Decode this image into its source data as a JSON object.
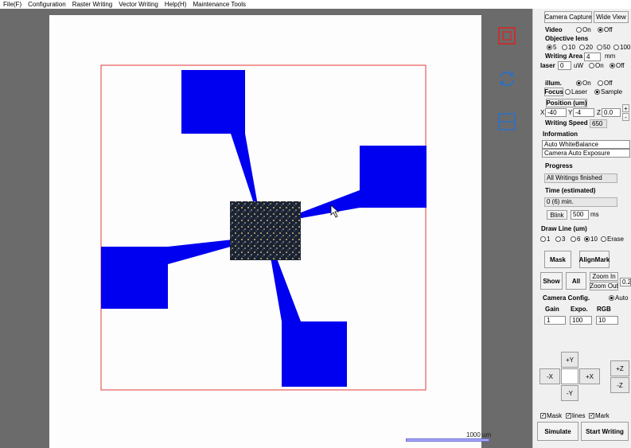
{
  "menu": [
    "File(F)",
    "Configuration",
    "Raster Writing",
    "Vector Writing",
    "Help(H)",
    "Maintenance Tools"
  ],
  "scale_label": "1000 um",
  "tool_icons": [
    "selection-rect-icon",
    "rotate-icon",
    "split-view-icon"
  ],
  "panel": {
    "camera_capture": "Camera Capture",
    "wide_view": "Wide View",
    "video_label": "Video",
    "video_on": "On",
    "video_off": "Off",
    "objective_label": "Objective lens",
    "objective_options": [
      "5",
      "10",
      "20",
      "50",
      "100"
    ],
    "objective_selected": "5",
    "writing_area_label": "Writing Area",
    "writing_area_value": "4",
    "writing_area_unit": "mm",
    "laser_label": "laser",
    "laser_value": "0",
    "laser_unit": "uW",
    "laser_on": "On",
    "laser_off": "Off",
    "illum_label": "illum.",
    "illum_on": "On",
    "illum_off": "Off",
    "focus_label": "Focus",
    "focus_laser": "Laser",
    "focus_sample": "Sample",
    "position_label": "Position (um)",
    "pos_x_label": "X",
    "pos_x": "-40",
    "pos_y_label": "Y",
    "pos_y": "-4",
    "pos_z_label": "Z",
    "pos_z": "0.0",
    "plus": "+",
    "minus": "-",
    "writing_speed_label": "Writing Speed",
    "writing_speed": "650",
    "information_label": "Information",
    "info_lines": [
      "Auto WhiteBalance",
      "Camera Auto Exposure"
    ],
    "progress_label": "Progress",
    "progress_value": "All Writings finished",
    "time_label": "Time (estimated)",
    "time_value": "0 (6) min.",
    "blink_label": "Blink",
    "blink_value": "500",
    "blink_unit": "ms",
    "draw_line_label": "Draw Line (um)",
    "draw_options": [
      "1",
      "3",
      "6",
      "10",
      "Erase"
    ],
    "draw_selected": "10",
    "mask_btn": "Mask",
    "alignmark_btn": "AlignMark",
    "show_btn": "Show",
    "all_btn": "All",
    "zoom_in": "Zoom In",
    "zoom_out": "Zoom Out",
    "zoom_value": "0.2",
    "camera_config_label": "Camera Config.",
    "auto_label": "Auto",
    "gain_label": "Gain",
    "expo_label": "Expo.",
    "rgb_label": "RGB",
    "gain_value": "1",
    "expo_value": "100",
    "rgb_value": "10",
    "jog_plus_y": "+Y",
    "jog_minus_y": "-Y",
    "jog_plus_x": "+X",
    "jog_minus_x": "-X",
    "jog_plus_z": "+Z",
    "jog_minus_z": "-Z",
    "chk_mask": "Mask",
    "chk_lines": "lines",
    "chk_mark": "Mark",
    "simulate_btn": "Simulate",
    "start_writing_btn": "Start Writing"
  }
}
